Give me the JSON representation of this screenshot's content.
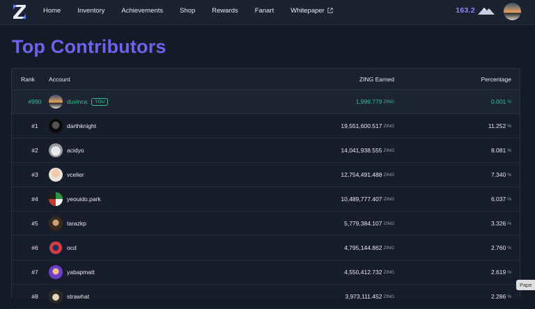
{
  "nav": {
    "links": [
      "Home",
      "Inventory",
      "Achievements",
      "Shop",
      "Rewards",
      "Fanart",
      "Whitepaper"
    ],
    "balance": "163.2",
    "icons": {
      "logo": "z-logo-icon",
      "external": "external-link-icon",
      "mountain": "mountain-icon"
    }
  },
  "title": "Top Contributors",
  "table": {
    "headers": {
      "rank": "Rank",
      "account": "Account",
      "zing": "ZING Earned",
      "percentage": "Percentage"
    },
    "unit_zing": "ZING",
    "unit_pct": "%",
    "you_badge": "YOU",
    "rows": [
      {
        "rank": "#990",
        "account": "duvinca",
        "zing": "1,999.779",
        "pct": "0.001"
      },
      {
        "rank": "#1",
        "account": "darthknight",
        "zing": "19,551,600.517",
        "pct": "11.252"
      },
      {
        "rank": "#2",
        "account": "acidyo",
        "zing": "14,041,938.555",
        "pct": "8.081"
      },
      {
        "rank": "#3",
        "account": "vcelier",
        "zing": "12,754,491.488",
        "pct": "7.340"
      },
      {
        "rank": "#4",
        "account": "yeouido.park",
        "zing": "10,489,777.407",
        "pct": "6.037"
      },
      {
        "rank": "#5",
        "account": "tarazkp",
        "zing": "5,779,384.107",
        "pct": "3.326"
      },
      {
        "rank": "#6",
        "account": "ocd",
        "zing": "4,795,144.862",
        "pct": "2.760"
      },
      {
        "rank": "#7",
        "account": "yabapmatt",
        "zing": "4,550,412.732",
        "pct": "2.619"
      },
      {
        "rank": "#8",
        "account": "strawhat",
        "zing": "3,973,111.452",
        "pct": "2.286"
      }
    ]
  },
  "paper_tab": "Pape",
  "colors": {
    "accent": "#6d63ee",
    "highlight": "#2fc28e",
    "background": "#141a26"
  }
}
